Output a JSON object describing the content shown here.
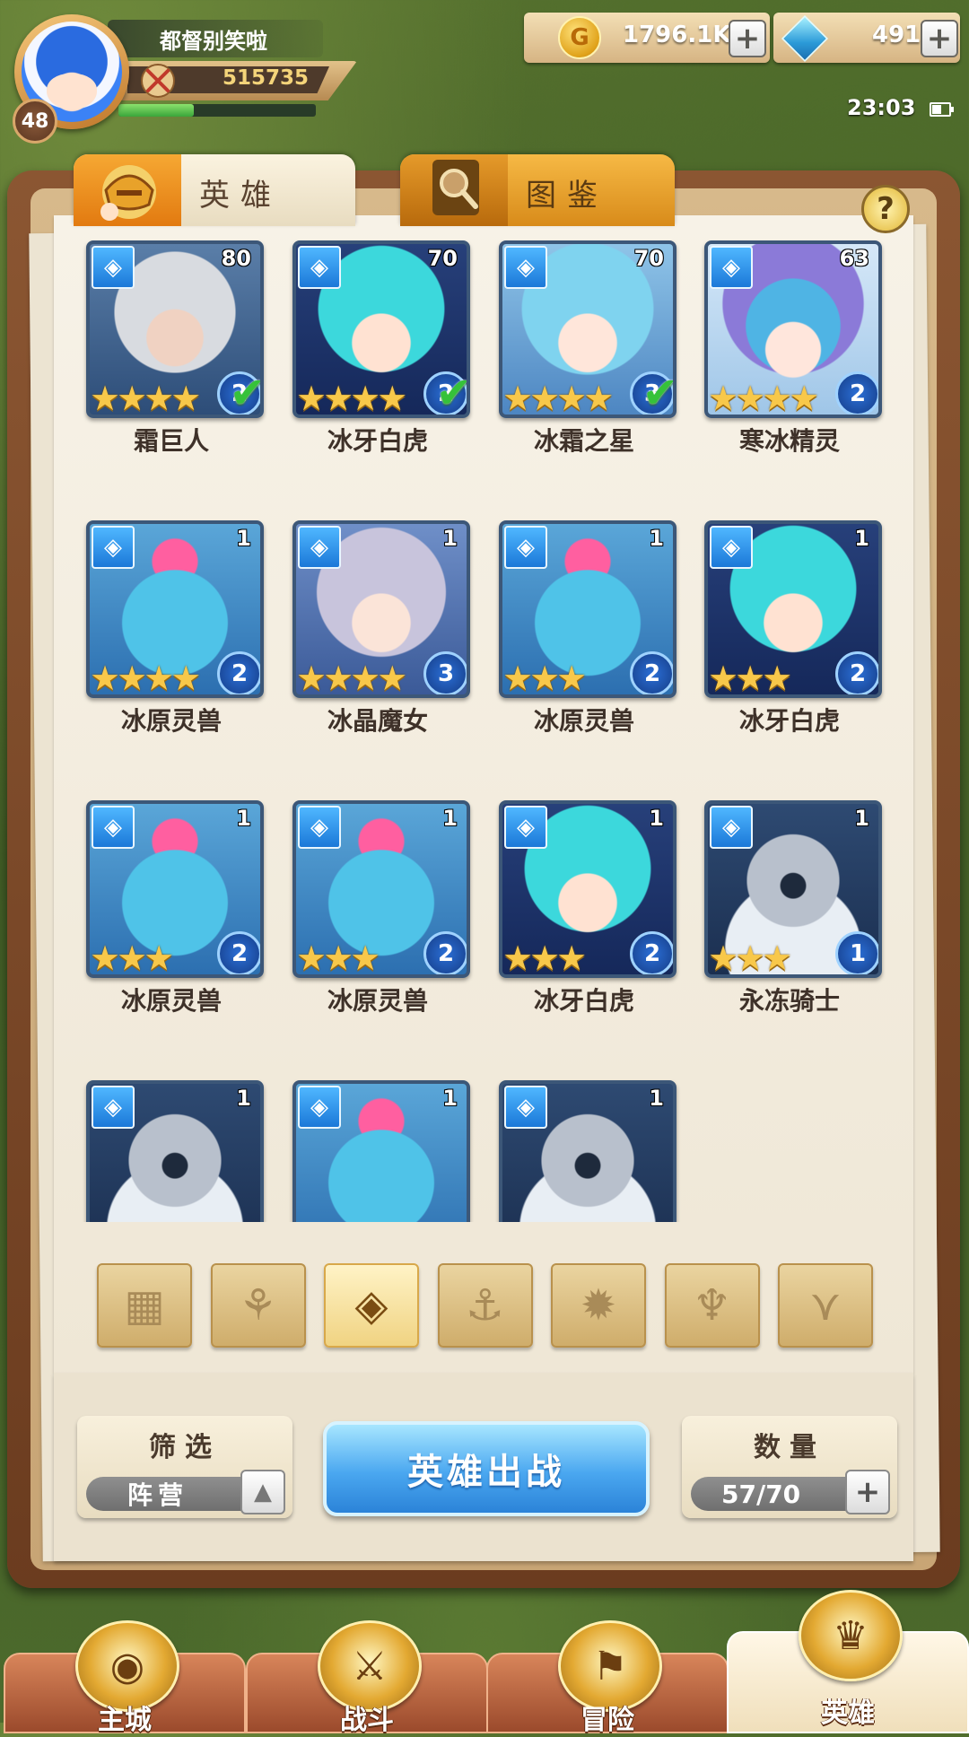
{
  "player": {
    "name": "都督别笑啦",
    "level": "48",
    "power": "515735",
    "xp_fraction": 0.38
  },
  "currencies": {
    "gold": "1796.1K",
    "gems": "491"
  },
  "status": {
    "time": "23:03"
  },
  "tabs": {
    "heroes": "英雄",
    "codex": "图鉴"
  },
  "heroes": [
    {
      "name": "霜巨人",
      "level": "80",
      "grade": "2",
      "stars": 4,
      "check": true,
      "art": "giant"
    },
    {
      "name": "冰牙白虎",
      "level": "70",
      "grade": "2",
      "stars": 4,
      "check": true,
      "art": "tiger"
    },
    {
      "name": "冰霜之星",
      "level": "70",
      "grade": "3",
      "stars": 4,
      "check": true,
      "art": "star"
    },
    {
      "name": "寒冰精灵",
      "level": "63",
      "grade": "2",
      "stars": 4,
      "check": false,
      "art": "spirit"
    },
    {
      "name": "冰原灵兽",
      "level": "1",
      "grade": "2",
      "stars": 4,
      "check": false,
      "art": "beast"
    },
    {
      "name": "冰晶魔女",
      "level": "1",
      "grade": "3",
      "stars": 4,
      "check": false,
      "art": "witch"
    },
    {
      "name": "冰原灵兽",
      "level": "1",
      "grade": "2",
      "stars": 3,
      "check": false,
      "art": "beast"
    },
    {
      "name": "冰牙白虎",
      "level": "1",
      "grade": "2",
      "stars": 3,
      "check": false,
      "art": "tiger"
    },
    {
      "name": "冰原灵兽",
      "level": "1",
      "grade": "2",
      "stars": 3,
      "check": false,
      "art": "beast"
    },
    {
      "name": "冰原灵兽",
      "level": "1",
      "grade": "2",
      "stars": 3,
      "check": false,
      "art": "beast"
    },
    {
      "name": "冰牙白虎",
      "level": "1",
      "grade": "2",
      "stars": 3,
      "check": false,
      "art": "tiger"
    },
    {
      "name": "永冻骑士",
      "level": "1",
      "grade": "1",
      "stars": 3,
      "check": false,
      "art": "knight"
    },
    {
      "name": "",
      "level": "1",
      "grade": "",
      "stars": 0,
      "check": false,
      "art": "knight"
    },
    {
      "name": "",
      "level": "1",
      "grade": "",
      "stars": 0,
      "check": false,
      "art": "beast"
    },
    {
      "name": "",
      "level": "1",
      "grade": "",
      "stars": 0,
      "check": false,
      "art": "knight"
    }
  ],
  "filters": [
    {
      "icon": "all-grid-icon",
      "glyph": "▦",
      "active": false
    },
    {
      "icon": "faction-forest-icon",
      "glyph": "⚘",
      "active": false
    },
    {
      "icon": "faction-ice-icon",
      "glyph": "◈",
      "active": true
    },
    {
      "icon": "faction-sea-icon",
      "glyph": "⚓",
      "active": false
    },
    {
      "icon": "faction-beast-icon",
      "glyph": "✹",
      "active": false
    },
    {
      "icon": "faction-demon-icon",
      "glyph": "♆",
      "active": false
    },
    {
      "icon": "faction-divine-icon",
      "glyph": "⋎",
      "active": false
    }
  ],
  "controls": {
    "filter_title": "筛选",
    "filter_value": "阵营",
    "deploy_label": "英雄出战",
    "count_title": "数量",
    "count_value": "57/70"
  },
  "nav": [
    {
      "label": "主城",
      "icon": "main-city-icon",
      "glyph": "◉",
      "active": false
    },
    {
      "label": "战斗",
      "icon": "battle-swords-icon",
      "glyph": "⚔",
      "active": false
    },
    {
      "label": "冒险",
      "icon": "adventure-scroll-icon",
      "glyph": "⚑",
      "active": false
    },
    {
      "label": "英雄",
      "icon": "hero-helmet-icon",
      "glyph": "♛",
      "active": true
    }
  ]
}
